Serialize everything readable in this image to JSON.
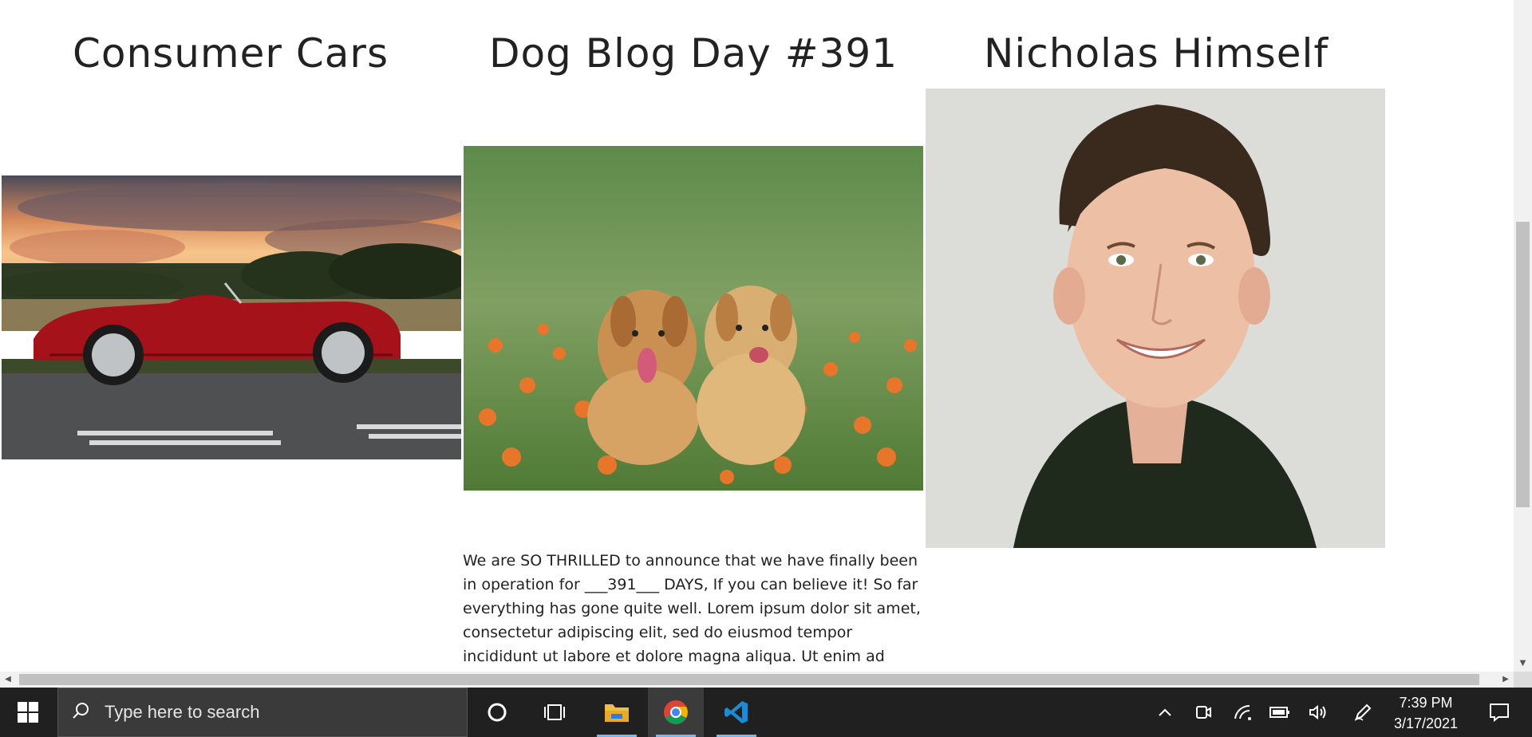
{
  "columns": [
    {
      "title": "Consumer Cars",
      "image": "red-vintage-convertible-at-sunset"
    },
    {
      "title": "Dog Blog Day #391",
      "image": "two-golden-retriever-puppies-in-flowers"
    },
    {
      "title": "Nicholas Himself",
      "image": "portrait-of-smiling-man"
    }
  ],
  "blog": {
    "text": "We are SO THRILLED to announce that we have finally been in operation for ___391___ DAYS, If you can believe it! So far everything has gone quite well. Lorem ipsum dolor sit amet, consectetur adipiscing elit, sed do eiusmod tempor incididunt ut labore et dolore magna aliqua. Ut enim ad"
  },
  "taskbar": {
    "search_placeholder": "Type here to search",
    "time": "7:39 PM",
    "date": "3/17/2021",
    "apps": [
      "windows-start-icon",
      "cortana-icon",
      "task-view-icon",
      "file-explorer-icon",
      "chrome-icon",
      "vscode-icon"
    ],
    "tray": [
      "chevron-up-icon",
      "meet-now-icon",
      "wifi-icon",
      "battery-icon",
      "volume-icon",
      "pen-icon",
      "notification-icon"
    ]
  },
  "colors": {
    "taskbar_bg": "#202020",
    "search_bg": "#3a3a3a",
    "scrollbar_thumb": "#c1c1c1"
  }
}
